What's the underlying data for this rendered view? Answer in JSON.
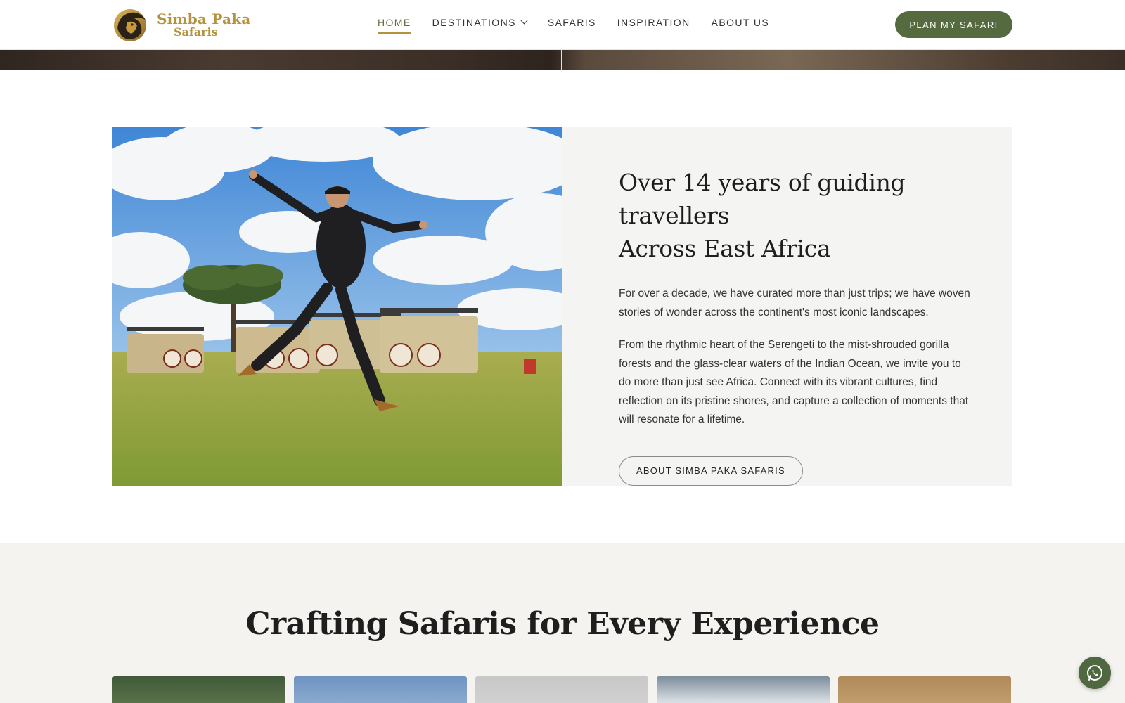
{
  "brand": {
    "name_line1": "Simba Paka",
    "name_line2": "Safaris",
    "logo_icon": "lion-head-icon",
    "accent_color": "#b5923c",
    "primary_color": "#556b3f"
  },
  "nav": {
    "items": [
      {
        "label": "HOME",
        "active": true
      },
      {
        "label": "DESTINATIONS",
        "has_dropdown": true
      },
      {
        "label": "SAFARIS"
      },
      {
        "label": "INSPIRATION"
      },
      {
        "label": "ABOUT US"
      }
    ],
    "cta_label": "PLAN MY SAFARI"
  },
  "about": {
    "title_line1": "Over 14 years of guiding travellers",
    "title_line2": "Across East Africa",
    "paragraph1": "For over a decade, we have curated more than just trips; we have woven stories of wonder across the continent's most iconic landscapes.",
    "paragraph2": "From the rhythmic heart of the Serengeti to the mist-shrouded gorilla forests and the glass-clear waters of the Indian Ocean, we invite you to do more than just see Africa. Connect with its vibrant cultures, find reflection on its pristine shores, and capture a collection of moments that will resonate for a lifetime.",
    "button_label": "ABOUT SIMBA PAKA SAFARIS",
    "photo_icon": "traveller-jumping-safari-photo"
  },
  "experiences": {
    "title": "Crafting Safaris for Every Experience",
    "cards": [
      "forest-card",
      "beach-card",
      "loading-card",
      "mountain-card",
      "desert-card"
    ]
  },
  "floating": {
    "whatsapp_icon": "whatsapp-icon"
  }
}
